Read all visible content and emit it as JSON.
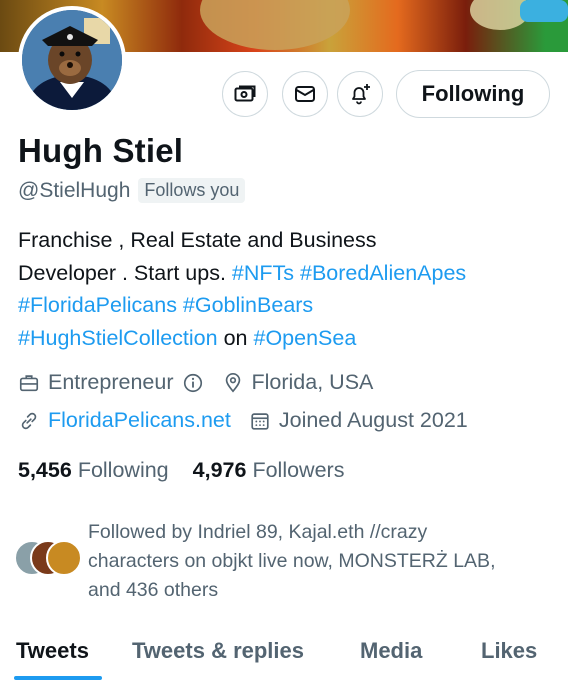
{
  "profile": {
    "name": "Hugh Stiel",
    "handle": "@StielHugh",
    "follows_you": "Follows you"
  },
  "actions": {
    "follow_label": "Following"
  },
  "bio": {
    "line1": "Franchise , Real Estate and Business",
    "line2_text": "Developer . Start ups.",
    "line2_tags": "#NFTs #BoredAlienApes",
    "line3_tags": "#FloridaPelicans #GoblinBears",
    "line4_tag1": "#HughStielCollection",
    "line4_on": "on",
    "line4_tag2": "#OpenSea"
  },
  "meta": {
    "profession": "Entrepreneur",
    "location": "Florida, USA",
    "website": "FloridaPelicans.net",
    "joined": "Joined August 2021"
  },
  "counts": {
    "following_count": "5,456",
    "following_label": "Following",
    "followers_count": "4,976",
    "followers_label": "Followers"
  },
  "followed_by": {
    "line1": "Followed by Indriel 89, Kajal.eth //crazy",
    "line2": "characters on objkt live now, MONSTERŻ LAB,",
    "line3": "and 436 others"
  },
  "tabs": {
    "tweets": "Tweets",
    "replies": "Tweets & replies",
    "media": "Media",
    "likes": "Likes"
  },
  "colors": {
    "accent": "#1d9bf0",
    "secondary_text": "#536471",
    "primary_text": "#0f1419"
  },
  "icons": [
    "money-icon",
    "mail-icon",
    "notification-bell-plus-icon",
    "briefcase-icon",
    "info-icon",
    "location-pin-icon",
    "link-icon",
    "calendar-icon"
  ]
}
